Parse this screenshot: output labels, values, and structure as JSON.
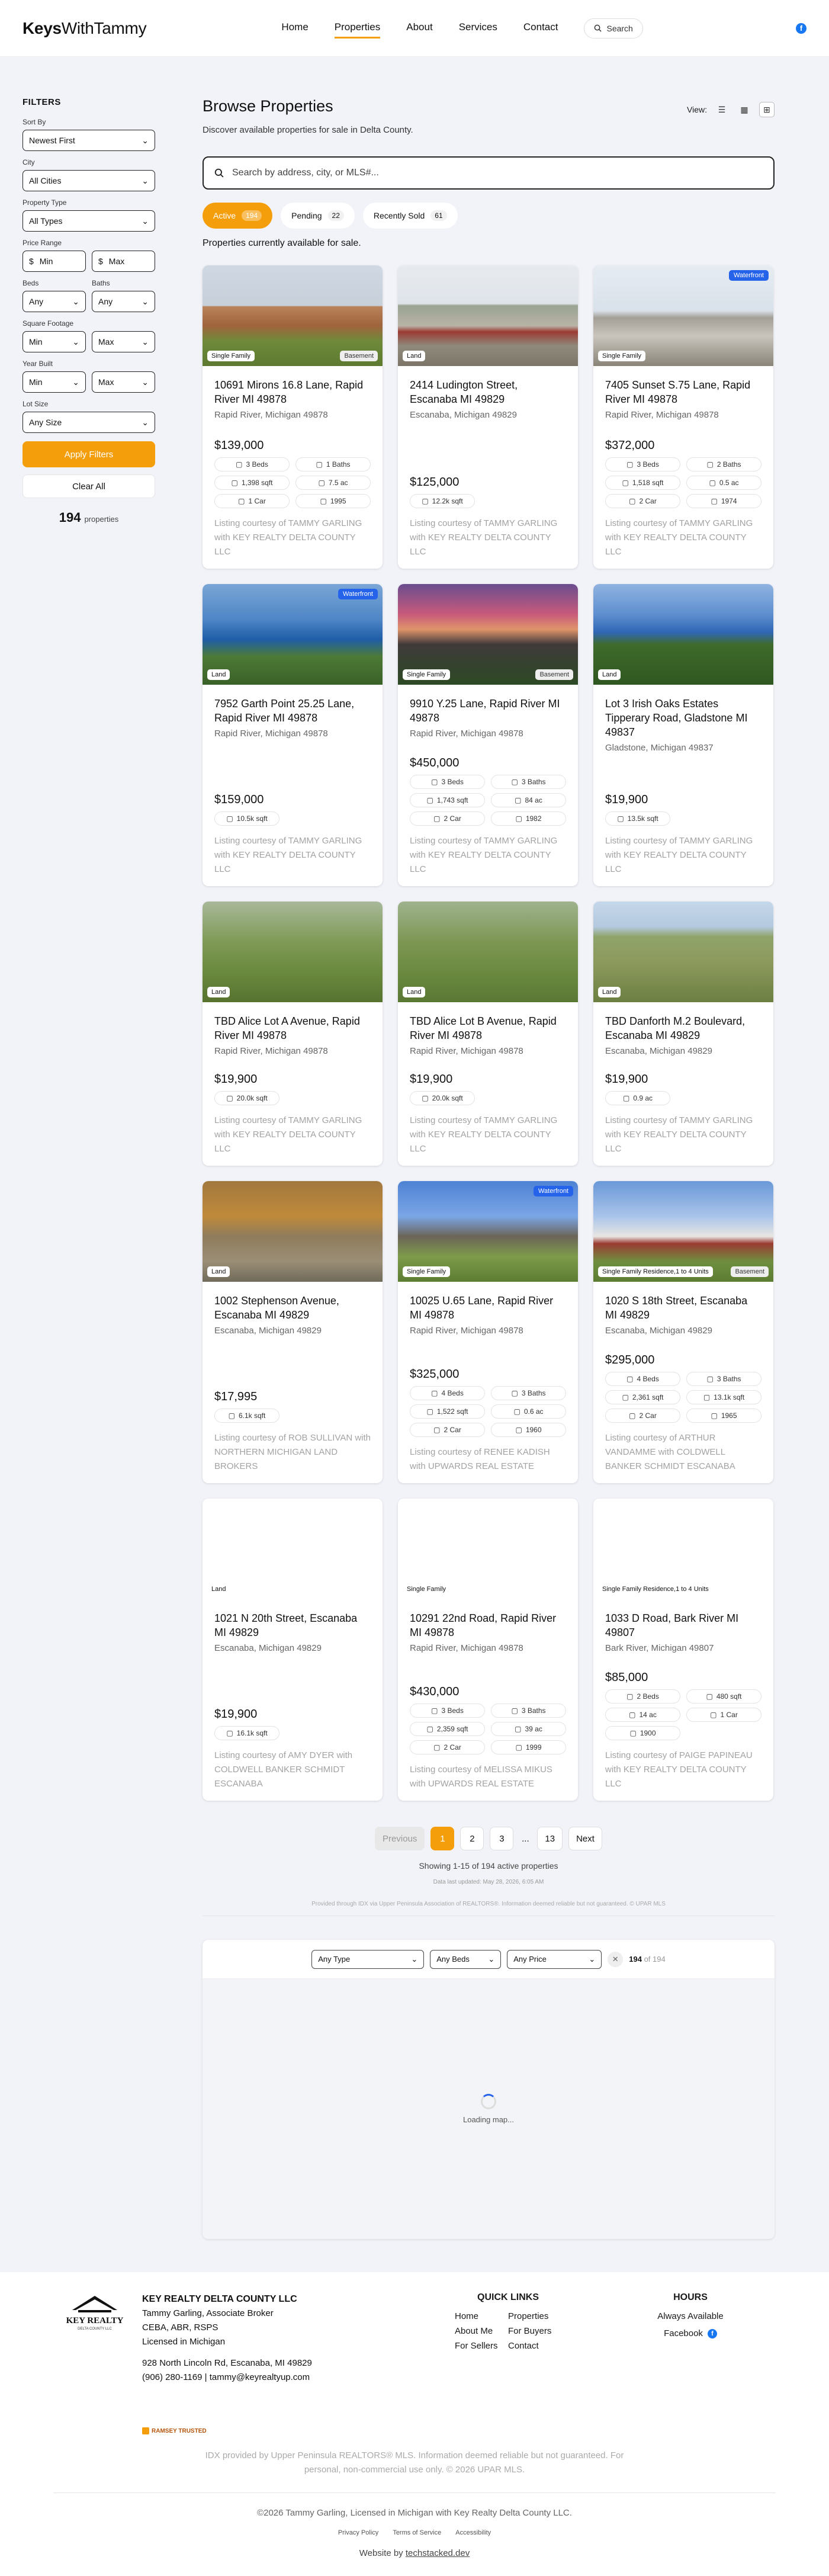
{
  "header": {
    "brand_bold": "Keys",
    "brand_rest": "WithTammy",
    "nav": [
      "Home",
      "Properties",
      "About",
      "Services",
      "Contact"
    ],
    "search_label": "Search",
    "facebook": "f"
  },
  "sidebar": {
    "title": "FILTERS",
    "sort_label": "Sort By",
    "sort_value": "Newest First",
    "city_label": "City",
    "city_value": "All Cities",
    "type_label": "Property Type",
    "type_value": "All Types",
    "price_label": "Price Range",
    "price_min": "Min",
    "price_max": "Max",
    "currency": "$",
    "beds_label": "Beds",
    "beds_value": "Any",
    "baths_label": "Baths",
    "baths_value": "Any",
    "sqft_label": "Square Footage",
    "sqft_min": "Min",
    "sqft_max": "Max",
    "year_label": "Year Built",
    "year_min": "Min",
    "year_max": "Max",
    "lot_label": "Lot Size",
    "lot_value": "Any Size",
    "apply": "Apply Filters",
    "clear": "Clear All",
    "count": "194",
    "count_label": "properties"
  },
  "main": {
    "title": "Browse Properties",
    "subtitle": "Discover available properties for sale in Delta County.",
    "view_label": "View:",
    "search_placeholder": "Search by address, city, or MLS#...",
    "tabs": [
      {
        "label": "Active",
        "count": "194"
      },
      {
        "label": "Pending",
        "count": "22"
      },
      {
        "label": "Recently Sold",
        "count": "61"
      }
    ],
    "status_line": "Properties currently available for sale."
  },
  "listings": [
    {
      "address": "10691 Mirons 16.8 Lane, Rapid River MI 49878",
      "city": "Rapid River, Michigan 49878",
      "price": "$139,000",
      "type": "Single Family",
      "extra": "Basement",
      "waterfront": "",
      "chips": [
        "3 Beds",
        "1 Baths",
        "1,398 sqft",
        "7.5 ac",
        "1 Car",
        "1995"
      ],
      "courtesy": "Listing courtesy of TAMMY GARLING with KEY REALTY DELTA COUNTY LLC"
    },
    {
      "address": "2414 Ludington Street, Escanaba MI 49829",
      "city": "Escanaba, Michigan 49829",
      "price": "$125,000",
      "type": "Land",
      "extra": "",
      "waterfront": "",
      "chips": [
        "12.2k sqft"
      ],
      "courtesy": "Listing courtesy of TAMMY GARLING with KEY REALTY DELTA COUNTY LLC"
    },
    {
      "address": "7405 Sunset S.75 Lane, Rapid River MI 49878",
      "city": "Rapid River, Michigan 49878",
      "price": "$372,000",
      "type": "Single Family",
      "extra": "",
      "waterfront": "Waterfront",
      "chips": [
        "3 Beds",
        "2 Baths",
        "1,518 sqft",
        "0.5 ac",
        "2 Car",
        "1974"
      ],
      "courtesy": "Listing courtesy of TAMMY GARLING with KEY REALTY DELTA COUNTY LLC"
    },
    {
      "address": "7952 Garth Point 25.25 Lane, Rapid River MI 49878",
      "city": "Rapid River, Michigan 49878",
      "price": "$159,000",
      "type": "Land",
      "extra": "",
      "waterfront": "Waterfront",
      "chips": [
        "10.5k sqft"
      ],
      "courtesy": "Listing courtesy of TAMMY GARLING with KEY REALTY DELTA COUNTY LLC"
    },
    {
      "address": "9910 Y.25 Lane, Rapid River MI 49878",
      "city": "Rapid River, Michigan 49878",
      "price": "$450,000",
      "type": "Single Family",
      "extra": "Basement",
      "waterfront": "",
      "chips": [
        "3 Beds",
        "3 Baths",
        "1,743 sqft",
        "84 ac",
        "2 Car",
        "1982"
      ],
      "courtesy": "Listing courtesy of TAMMY GARLING with KEY REALTY DELTA COUNTY LLC"
    },
    {
      "address": "Lot 3 Irish Oaks Estates Tipperary Road, Gladstone MI 49837",
      "city": "Gladstone, Michigan 49837",
      "price": "$19,900",
      "type": "Land",
      "extra": "",
      "waterfront": "",
      "chips": [
        "13.5k sqft"
      ],
      "courtesy": "Listing courtesy of TAMMY GARLING with KEY REALTY DELTA COUNTY LLC"
    },
    {
      "address": "TBD Alice Lot A Avenue, Rapid River MI 49878",
      "city": "Rapid River, Michigan 49878",
      "price": "$19,900",
      "type": "Land",
      "extra": "",
      "waterfront": "",
      "chips": [
        "20.0k sqft"
      ],
      "courtesy": "Listing courtesy of TAMMY GARLING with KEY REALTY DELTA COUNTY LLC"
    },
    {
      "address": "TBD Alice Lot B Avenue, Rapid River MI 49878",
      "city": "Rapid River, Michigan 49878",
      "price": "$19,900",
      "type": "Land",
      "extra": "",
      "waterfront": "",
      "chips": [
        "20.0k sqft"
      ],
      "courtesy": "Listing courtesy of TAMMY GARLING with KEY REALTY DELTA COUNTY LLC"
    },
    {
      "address": "TBD Danforth M.2 Boulevard, Escanaba MI 49829",
      "city": "Escanaba, Michigan 49829",
      "price": "$19,900",
      "type": "Land",
      "extra": "",
      "waterfront": "",
      "chips": [
        "0.9 ac"
      ],
      "courtesy": "Listing courtesy of TAMMY GARLING with KEY REALTY DELTA COUNTY LLC"
    },
    {
      "address": "1002 Stephenson Avenue, Escanaba MI 49829",
      "city": "Escanaba, Michigan 49829",
      "price": "$17,995",
      "type": "Land",
      "extra": "",
      "waterfront": "",
      "chips": [
        "6.1k sqft"
      ],
      "courtesy": "Listing courtesy of ROB SULLIVAN with NORTHERN MICHIGAN LAND BROKERS"
    },
    {
      "address": "10025 U.65 Lane, Rapid River MI 49878",
      "city": "Rapid River, Michigan 49878",
      "price": "$325,000",
      "type": "Single Family",
      "extra": "",
      "waterfront": "Waterfront",
      "chips": [
        "4 Beds",
        "3 Baths",
        "1,522 sqft",
        "0.6 ac",
        "2 Car",
        "1960"
      ],
      "courtesy": "Listing courtesy of RENEE KADISH with UPWARDS REAL ESTATE"
    },
    {
      "address": "1020 S 18th Street, Escanaba MI 49829",
      "city": "Escanaba, Michigan 49829",
      "price": "$295,000",
      "type": "Single Family Residence,1 to 4 Units",
      "extra": "Basement",
      "waterfront": "",
      "chips": [
        "4 Beds",
        "3 Baths",
        "2,361 sqft",
        "13.1k sqft",
        "2 Car",
        "1965"
      ],
      "courtesy": "Listing courtesy of ARTHUR VANDAMME with COLDWELL BANKER SCHMIDT ESCANABA"
    },
    {
      "address": "1021 N 20th Street, Escanaba MI 49829",
      "city": "Escanaba, Michigan 49829",
      "price": "$19,900",
      "type": "Land",
      "extra": "",
      "waterfront": "",
      "chips": [
        "16.1k sqft"
      ],
      "courtesy": "Listing courtesy of AMY DYER with COLDWELL BANKER SCHMIDT ESCANABA"
    },
    {
      "address": "10291 22nd Road, Rapid River MI 49878",
      "city": "Rapid River, Michigan 49878",
      "price": "$430,000",
      "type": "Single Family",
      "extra": "",
      "waterfront": "",
      "chips": [
        "3 Beds",
        "3 Baths",
        "2,359 sqft",
        "39 ac",
        "2 Car",
        "1999"
      ],
      "courtesy": "Listing courtesy of MELISSA MIKUS with UPWARDS REAL ESTATE"
    },
    {
      "address": "1033 D Road, Bark River MI 49807",
      "city": "Bark River, Michigan 49807",
      "price": "$85,000",
      "type": "Single Family Residence,1 to 4 Units",
      "extra": "",
      "waterfront": "",
      "chips": [
        "2 Beds",
        "480 sqft",
        "14 ac",
        "1 Car",
        "1900"
      ],
      "courtesy": "Listing courtesy of PAIGE PAPINEAU with KEY REALTY DELTA COUNTY LLC"
    }
  ],
  "pagination": {
    "prev": "Previous",
    "pages": [
      "1",
      "2",
      "3",
      "...",
      "13"
    ],
    "next": "Next",
    "showing": "Showing 1-15 of 194 active properties",
    "updated": "Data last updated: May 28, 2026, 6:05 AM",
    "provided": "Provided through IDX via Upper Peninsula Association of REALTORS®. Information deemed reliable but not guaranteed. © UPAR MLS"
  },
  "map": {
    "type": "Any Type",
    "beds": "Any Beds",
    "price": "Any Price",
    "clear": "✕",
    "count": "194",
    "of": "of 194",
    "loading": "Loading map..."
  },
  "footer": {
    "logo_top": "KEY REALTY",
    "logo_sub": "DELTA COUNTY LLC",
    "office": "KEY REALTY DELTA COUNTY LLC",
    "agent": "Tammy Garling, Associate Broker",
    "creds": "CEBA, ABR, RSPS",
    "licensed": "Licensed in Michigan",
    "address": "928 North Lincoln Rd, Escanaba, MI 49829",
    "contact": "(906) 280-1169 | tammy@keyrealtyup.com",
    "ramsey": "RAMSEY TRUSTED",
    "quick_title": "QUICK LINKS",
    "quick_links": [
      "Home",
      "Properties",
      "About Me",
      "For Buyers",
      "For Sellers",
      "Contact"
    ],
    "hours_title": "HOURS",
    "hours": "Always Available",
    "facebook": "Facebook",
    "idx_1": "IDX provided by Upper Peninsula REALTORS® MLS. Information deemed reliable but not guaranteed. For",
    "idx_2": "personal, non-commercial use only. © 2026 UPAR MLS.",
    "copyright": "©2026 Tammy Garling, Licensed in Michigan with Key Realty Delta County LLC.",
    "legal": [
      "Privacy Policy",
      "Terms of Service",
      "Accessibility"
    ],
    "website_prefix": "Website by ",
    "website_link": "techstacked.dev"
  },
  "colors": {
    "accent": "#f59e0b",
    "waterfront": "#2563eb",
    "facebook": "#1877f2",
    "background": "#f2f3f8"
  }
}
